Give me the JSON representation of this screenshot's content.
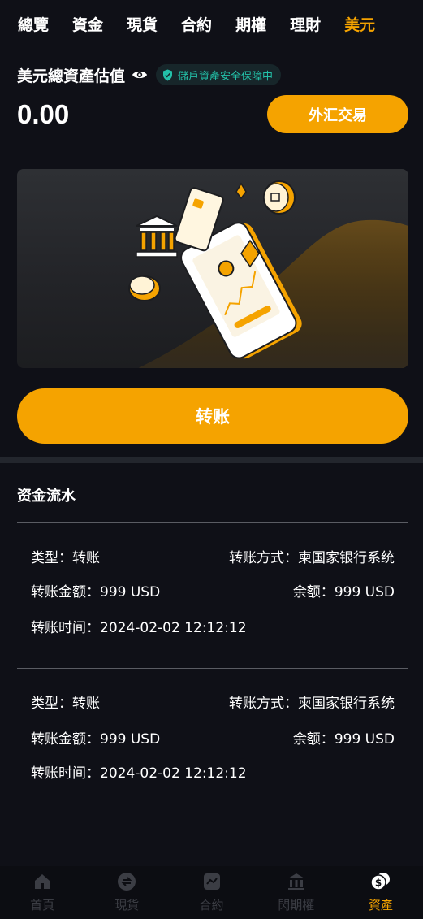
{
  "tabs": [
    {
      "label": "總覽"
    },
    {
      "label": "資金"
    },
    {
      "label": "現貨"
    },
    {
      "label": "合約"
    },
    {
      "label": "期權"
    },
    {
      "label": "理財"
    },
    {
      "label": "美元",
      "active": true
    }
  ],
  "asset": {
    "title": "美元總資產估值",
    "guard_text": "儲戶資產安全保障中",
    "balance": "0.00",
    "fx_button": "外汇交易"
  },
  "transfer_button": "转账",
  "flow": {
    "title": "资金流水",
    "records": [
      {
        "type_label": "类型：",
        "type": "转账",
        "method_label": "转账方式：",
        "method": "柬国家银行系统",
        "amount_label": "转账金额：",
        "amount": "999 USD",
        "balance_label": "余额：",
        "balance": "999 USD",
        "time_label": "转账时间：",
        "time": "2024-02-02 12:12:12"
      },
      {
        "type_label": "类型：",
        "type": "转账",
        "method_label": "转账方式：",
        "method": "柬国家银行系统",
        "amount_label": "转账金额：",
        "amount": "999 USD",
        "balance_label": "余额：",
        "balance": "999 USD",
        "time_label": "转账时间：",
        "time": "2024-02-02 12:12:12"
      }
    ]
  },
  "nav": [
    {
      "label": "首頁",
      "icon": "home-icon"
    },
    {
      "label": "現貨",
      "icon": "swap-icon"
    },
    {
      "label": "合約",
      "icon": "contract-icon"
    },
    {
      "label": "閃期權",
      "icon": "bank-icon"
    },
    {
      "label": "資產",
      "icon": "coins-icon",
      "active": true
    }
  ],
  "colors": {
    "accent": "#f5a300",
    "background": "#0f1017",
    "guard": "#23c0a8"
  }
}
